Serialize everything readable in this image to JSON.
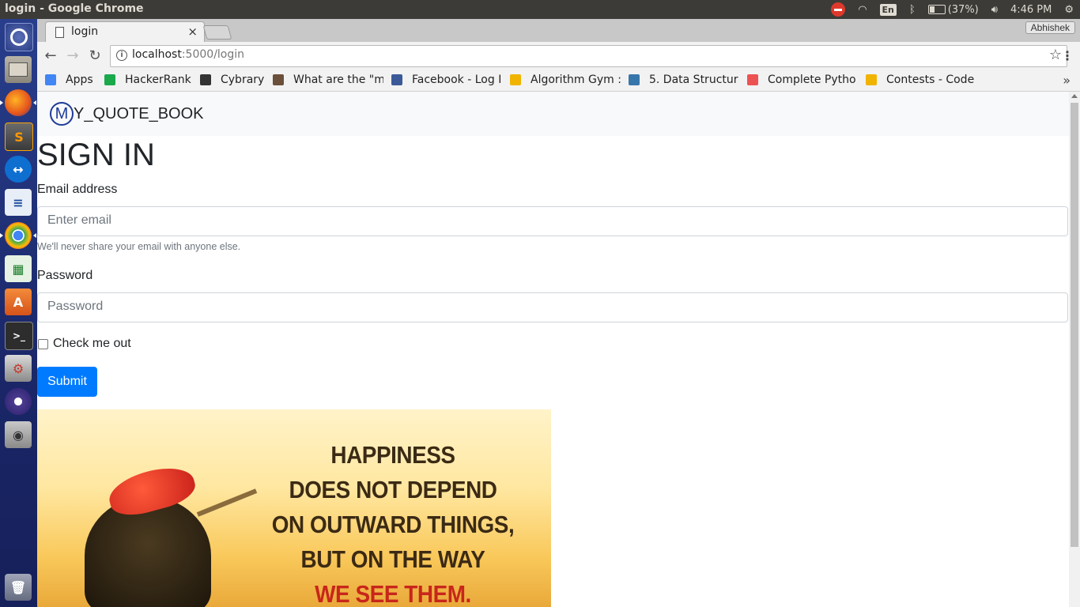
{
  "os": {
    "window_title": "login - Google Chrome",
    "keyboard_layout": "En",
    "battery": "(37%)",
    "time": "4:46 PM"
  },
  "launcher": {
    "icons": [
      "ubuntu-dash-icon",
      "files-icon",
      "firefox-icon",
      "sublime-text-icon",
      "teamviewer-icon",
      "writer-icon",
      "chrome-icon",
      "calc-icon",
      "software-center-icon",
      "terminal-icon",
      "system-settings-icon",
      "eclipse-icon",
      "screenshot-icon",
      "trash-icon"
    ]
  },
  "browser": {
    "tab_title": "login",
    "tab_close": "×",
    "profile_name": "Abhishek",
    "url_host": "localhost",
    "url_path": ":5000/login",
    "bookmarks": [
      {
        "label": "Apps",
        "icon": "apps-grid-icon",
        "color": "#4285f4"
      },
      {
        "label": "HackerRank",
        "icon": "hackerrank-icon",
        "color": "#1ba94c"
      },
      {
        "label": "Cybrary",
        "icon": "cybrary-icon",
        "color": "#333333"
      },
      {
        "label": "What are the \"m",
        "icon": "cc-icon",
        "color": "#6b4f3a"
      },
      {
        "label": "Facebook - Log I",
        "icon": "facebook-icon",
        "color": "#3b5998"
      },
      {
        "label": "Algorithm Gym :",
        "icon": "codeforces-icon",
        "color": "#f0b400"
      },
      {
        "label": "5. Data Structur",
        "icon": "python-icon",
        "color": "#3776ab"
      },
      {
        "label": "Complete Pytho",
        "icon": "udemy-icon",
        "color": "#ec5252"
      },
      {
        "label": "Contests - Code",
        "icon": "codeforces-icon",
        "color": "#f0b400"
      }
    ],
    "more_bookmarks": "»"
  },
  "page": {
    "brand_letter": "M",
    "brand_text": "Y_QUOTE_BOOK",
    "heading": "SIGN IN",
    "email_label": "Email address",
    "email_placeholder": "Enter email",
    "email_help": "We'll never share your email with anyone else.",
    "password_label": "Password",
    "password_placeholder": "Password",
    "checkbox_label": "Check me out",
    "submit_label": "Submit",
    "quote_lines": [
      "HAPPINESS",
      "DOES NOT DEPEND",
      "ON OUTWARD THINGS,",
      "BUT ON THE WAY"
    ],
    "quote_highlight": "WE SEE THEM.",
    "colors": {
      "primary": "#007bff",
      "brand": "#1e3b99",
      "quote_red": "#c8261b"
    }
  }
}
